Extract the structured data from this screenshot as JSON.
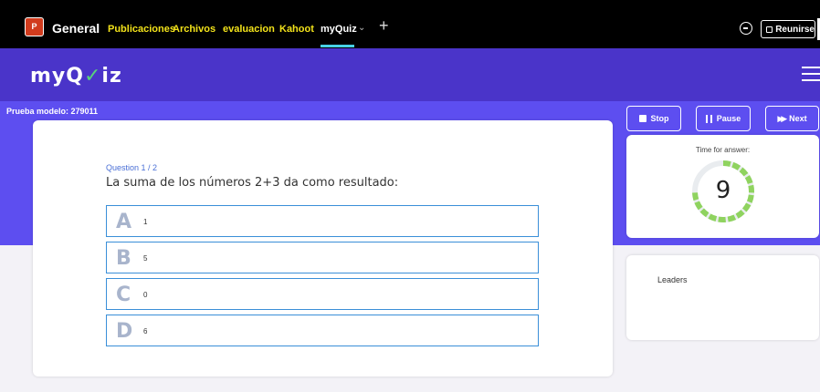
{
  "topbar": {
    "app_icon_letter": "P",
    "channel_name": "General",
    "tabs": [
      {
        "label": "Publicaciones",
        "active": false
      },
      {
        "label": "Archivos",
        "active": false
      },
      {
        "label": "evaluacion",
        "active": false
      },
      {
        "label": "Kahoot",
        "active": false
      },
      {
        "label": "myQuiz",
        "active": true
      }
    ],
    "add_tab_label": "+",
    "meet_label": "Reunirse",
    "icons": [
      "chat-icon",
      "camera-icon",
      "chevron-down-icon",
      "plus-icon"
    ]
  },
  "header": {
    "logo_prefix": "my",
    "logo_q": "Q",
    "logo_check": "✓",
    "logo_suffix": "iz",
    "menu_icon": "hamburger-icon"
  },
  "quiz": {
    "model_label": "Prueba modelo: 279011",
    "question_counter": "Question 1 / 2",
    "question_text": "La suma de los números 2+3 da como resultado:",
    "answers": [
      {
        "letter": "A",
        "text": "1"
      },
      {
        "letter": "B",
        "text": "5"
      },
      {
        "letter": "C",
        "text": "0"
      },
      {
        "letter": "D",
        "text": "6"
      }
    ]
  },
  "controls": {
    "stop_label": "Stop",
    "pause_label": "Pause",
    "next_label": "Next"
  },
  "timer": {
    "label": "Time for answer:",
    "value": "9",
    "remaining_fraction": 0.75
  },
  "leaders": {
    "title": "Leaders"
  },
  "colors": {
    "accent": "#5d4ef0",
    "header": "#4a34c9",
    "tab_highlight": "#f2e21a",
    "timer_green": "#8fd35f",
    "answer_border": "#3a8fd8"
  }
}
